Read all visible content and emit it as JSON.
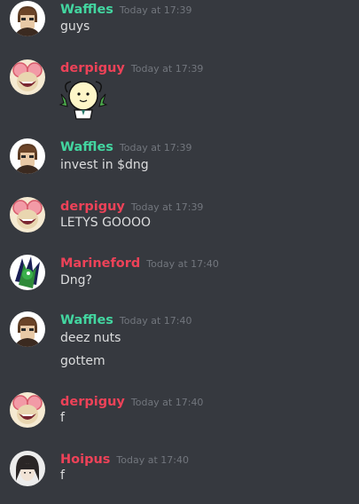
{
  "colors": {
    "background": "#36393f",
    "waffles": "#43d6a0",
    "derpiguy": "#ed4258",
    "marineford": "#ed4258",
    "hoipus": "#ed4258",
    "timestamp": "#72767d",
    "text": "#dcddde"
  },
  "messages": [
    {
      "user": "Waffles",
      "timestamp": "Today at 17:39",
      "avatar": "waffles-avatar",
      "lines": [
        "guys"
      ]
    },
    {
      "user": "derpiguy",
      "timestamp": "Today at 17:39",
      "avatar": "derpiguy-avatar",
      "sticker": "cartoon-character-sticker"
    },
    {
      "user": "Waffles",
      "timestamp": "Today at 17:39",
      "avatar": "waffles-avatar",
      "lines": [
        "invest in $dng"
      ]
    },
    {
      "user": "derpiguy",
      "timestamp": "Today at 17:39",
      "avatar": "derpiguy-avatar",
      "lines": [
        "LETYS GOOOO"
      ]
    },
    {
      "user": "Marineford",
      "timestamp": "Today at 17:40",
      "avatar": "marineford-avatar",
      "lines": [
        "Dng?"
      ]
    },
    {
      "user": "Waffles",
      "timestamp": "Today at 17:40",
      "avatar": "waffles-avatar",
      "lines": [
        "deez nuts",
        "gottem"
      ]
    },
    {
      "user": "derpiguy",
      "timestamp": "Today at 17:40",
      "avatar": "derpiguy-avatar",
      "lines": [
        "f"
      ]
    },
    {
      "user": "Hoipus",
      "timestamp": "Today at 17:40",
      "avatar": "hoipus-avatar",
      "lines": [
        "f"
      ]
    }
  ]
}
